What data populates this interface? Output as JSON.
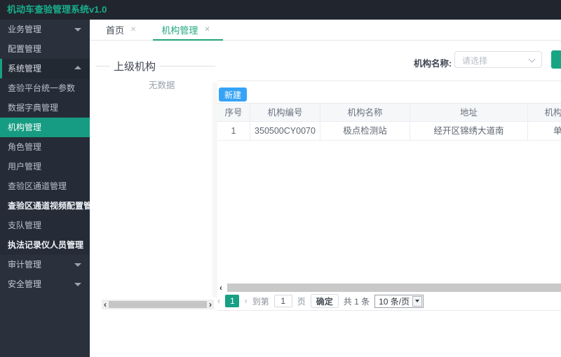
{
  "app": {
    "title": "机动车查验管理系统v1.0"
  },
  "sidebar": {
    "items": [
      {
        "label": "业务管理"
      },
      {
        "label": "配置管理"
      },
      {
        "label": "系统管理"
      },
      {
        "label": "查验平台统一参数"
      },
      {
        "label": "数据字典管理"
      },
      {
        "label": "机构管理"
      },
      {
        "label": "角色管理"
      },
      {
        "label": "用户管理"
      },
      {
        "label": "查验区通道管理"
      },
      {
        "label": "查验区通道视频配置管理"
      },
      {
        "label": "支队管理"
      },
      {
        "label": "执法记录仪人员管理"
      },
      {
        "label": "审计管理"
      },
      {
        "label": "安全管理"
      }
    ]
  },
  "tabs": [
    {
      "label": "首页"
    },
    {
      "label": "机构管理"
    }
  ],
  "search": {
    "label": "机构名称:",
    "placeholder": "请选择"
  },
  "tree_panel": {
    "legend": "上级机构",
    "empty_text": "无数据"
  },
  "table": {
    "new_button": "新建",
    "columns": [
      "序号",
      "机构编号",
      "机构名称",
      "地址",
      "机构类型"
    ],
    "rows": [
      [
        "1",
        "350500CY0070",
        "极点检测站",
        "经开区锦绣大道南",
        "单位"
      ]
    ]
  },
  "pagination": {
    "page": "1",
    "goto_label": "到第",
    "goto_value": "1",
    "page_unit": "页",
    "confirm": "确定",
    "total": "共 1 条",
    "page_size": "10 条/页"
  },
  "icons": {
    "close": "✕",
    "arrow_left": "‹",
    "arrow_right": "›"
  },
  "colors": {
    "accent_teal": "#17a084",
    "title_green": "#19ae8b",
    "button_blue": "#36a3f7",
    "sidebar_bg": "#2a303c",
    "header_bg": "#20252e"
  }
}
